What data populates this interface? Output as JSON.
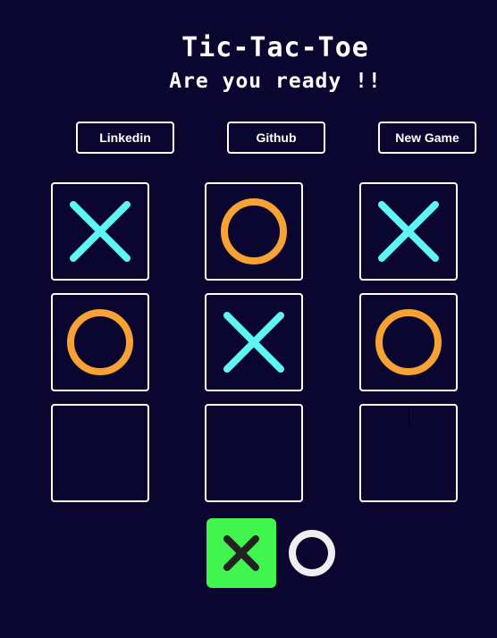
{
  "header": {
    "title": "Tic-Tac-Toe",
    "subtitle": "Are you ready !!"
  },
  "buttons": {
    "linkedin": "Linkedin",
    "github": "Github",
    "new_game": "New Game"
  },
  "board": [
    [
      "X",
      "O",
      "X"
    ],
    [
      "O",
      "X",
      "O"
    ],
    [
      "",
      "",
      ""
    ]
  ],
  "turn_indicator": {
    "active": "X",
    "options": [
      "X",
      "O"
    ]
  },
  "colors": {
    "background": "#0a0630",
    "x_mark": "#5ef5f5",
    "o_mark": "#f7a233",
    "active_turn_bg": "#41f44e",
    "turn_x_mark": "#222222",
    "turn_o_mark": "#eeeeee"
  }
}
